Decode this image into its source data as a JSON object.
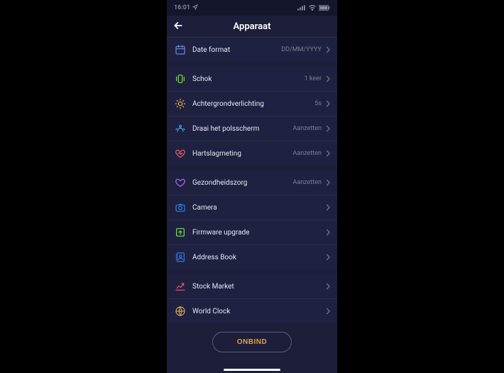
{
  "statusbar": {
    "time": "16:01"
  },
  "header": {
    "title": "Apparaat"
  },
  "groups": [
    {
      "rows": [
        {
          "name": "date-format",
          "label": "Date format",
          "value": "DD/MM/YYYY",
          "icon": "calendar",
          "color": "#6f8ad6"
        }
      ]
    },
    {
      "rows": [
        {
          "name": "shock",
          "label": "Schok",
          "value": "1 keer",
          "icon": "vibrate",
          "color": "#7fd95a"
        },
        {
          "name": "backlight",
          "label": "Achtergrondverlichting",
          "value": "5s",
          "icon": "sun",
          "color": "#e8b24a"
        },
        {
          "name": "wrist",
          "label": "Draai het polsscherm",
          "value": "Aanzetten",
          "icon": "wrist",
          "color": "#4aa7e8"
        },
        {
          "name": "heartrate",
          "label": "Hartslagmeting",
          "value": "Aanzetten",
          "icon": "heart",
          "color": "#e85a6f"
        }
      ]
    },
    {
      "rows": [
        {
          "name": "healthcare",
          "label": "Gezondheidszorg",
          "value": "Aanzetten",
          "icon": "healthheart",
          "color": "#b06fe8"
        },
        {
          "name": "camera",
          "label": "Camera",
          "value": "",
          "icon": "camera",
          "color": "#2e7de8"
        },
        {
          "name": "firmware",
          "label": "Firmware upgrade",
          "value": "",
          "icon": "upgrade",
          "color": "#7fd95a"
        },
        {
          "name": "addressbook",
          "label": "Address Book",
          "value": "",
          "icon": "addressbook",
          "color": "#2e7de8"
        }
      ]
    },
    {
      "rows": [
        {
          "name": "stockmarket",
          "label": "Stock Market",
          "value": "",
          "icon": "stock",
          "color": "#e85a6f"
        },
        {
          "name": "worldclock",
          "label": "World Clock",
          "value": "",
          "icon": "globe",
          "color": "#d9a24a"
        }
      ]
    }
  ],
  "unbind": {
    "label": "ONBIND"
  }
}
